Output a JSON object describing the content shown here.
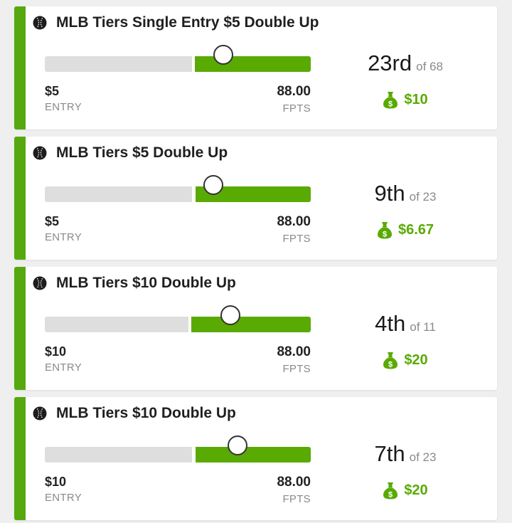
{
  "colors": {
    "accent_green": "#5aaa04",
    "track_gray": "#dedede",
    "label_gray": "#8a8a8a"
  },
  "icons": {
    "sport": "baseball-icon",
    "prize": "money-bag-icon"
  },
  "contests": [
    {
      "title": "MLB Tiers Single Entry $5 Double Up",
      "entry": "$5",
      "entry_label": "ENTRY",
      "fpts": "88.00",
      "fpts_label": "FPTS",
      "rank": "23rd",
      "of_total": "of 68",
      "prize": "$10",
      "progress": 0.55
    },
    {
      "title": "MLB Tiers $5 Double Up",
      "entry": "$5",
      "entry_label": "ENTRY",
      "fpts": "88.00",
      "fpts_label": "FPTS",
      "rank": "9th",
      "of_total": "of 23",
      "prize": "$6.67",
      "progress": 0.56
    },
    {
      "title": "MLB Tiers $10 Double Up",
      "entry": "$10",
      "entry_label": "ENTRY",
      "fpts": "88.00",
      "fpts_label": "FPTS",
      "rank": "4th",
      "of_total": "of 11",
      "prize": "$20",
      "progress": 0.54
    },
    {
      "title": "MLB Tiers $10 Double Up",
      "entry": "$10",
      "entry_label": "ENTRY",
      "fpts": "88.00",
      "fpts_label": "FPTS",
      "rank": "7th",
      "of_total": "of 23",
      "prize": "$20",
      "progress": 0.56
    }
  ]
}
